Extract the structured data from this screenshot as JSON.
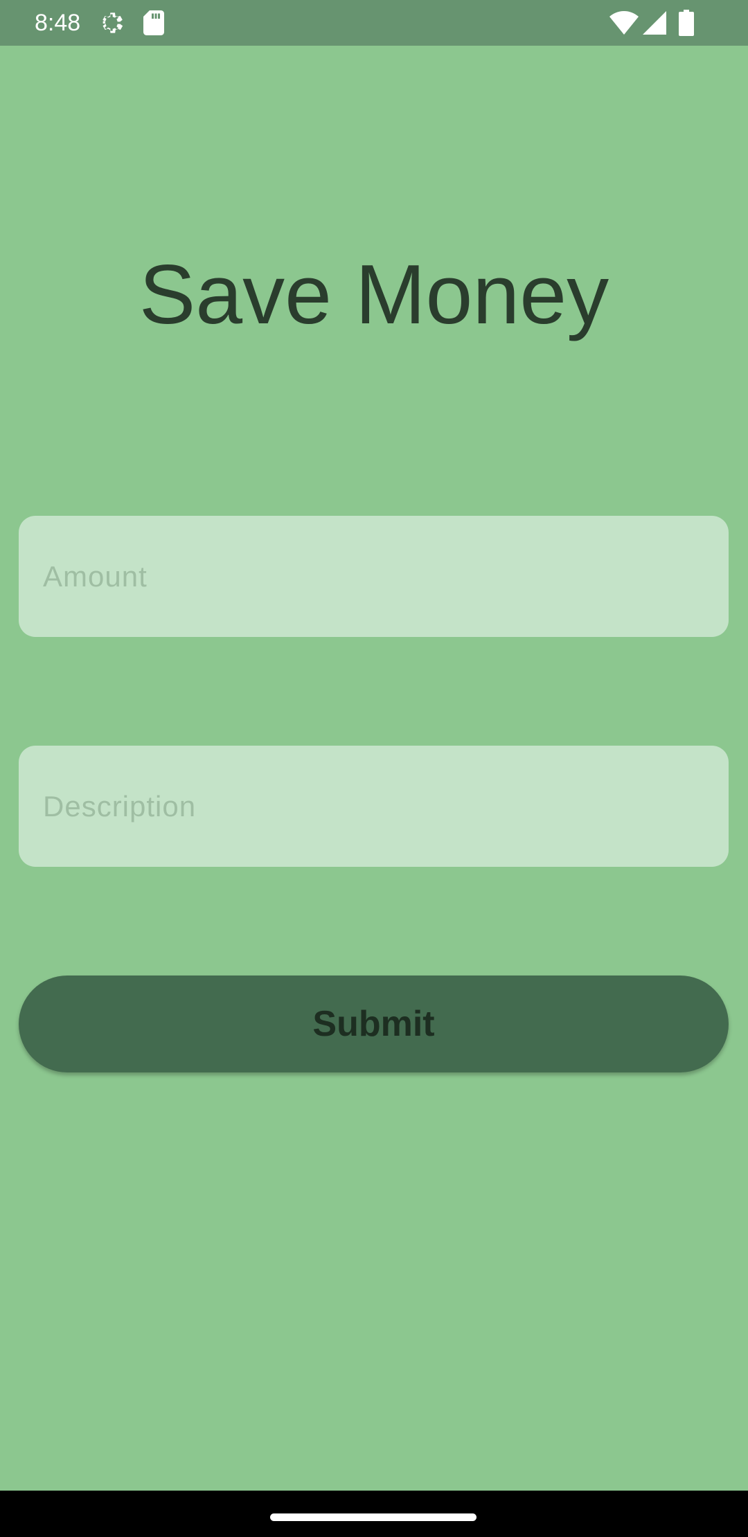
{
  "status_bar": {
    "time": "8:48",
    "left_icons": [
      "settings-icon",
      "sd-card-icon"
    ],
    "right_icons": [
      "wifi-icon",
      "cell-signal-icon",
      "battery-icon"
    ],
    "background": "#679470"
  },
  "screen": {
    "title": "Save Money",
    "background": "#8cc78f"
  },
  "form": {
    "amount": {
      "value": "",
      "placeholder": "Amount"
    },
    "description": {
      "value": "",
      "placeholder": "Description"
    },
    "submit_label": "Submit",
    "field_color": "#c4e3c8",
    "button_color": "#436b4f"
  },
  "nav_bar": {
    "background": "#000000"
  }
}
